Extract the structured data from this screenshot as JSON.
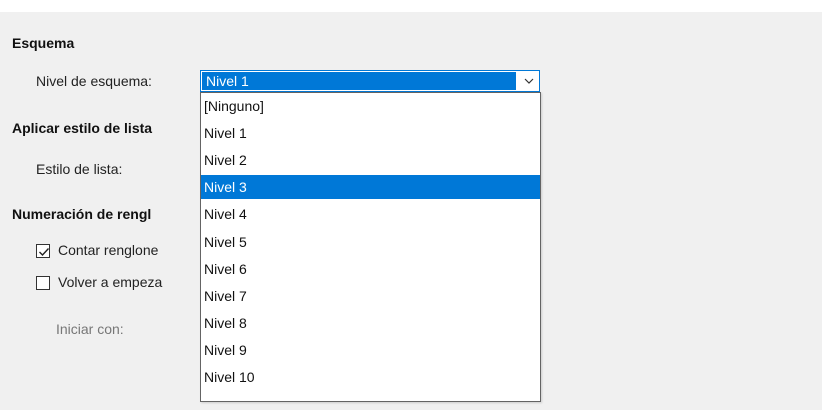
{
  "sections": {
    "outline": {
      "heading": "Esquema",
      "level_label": "Nivel de esquema:",
      "level_value": "Nivel 1"
    },
    "list_style": {
      "heading": "Aplicar estilo de lista",
      "style_label": "Estilo de lista:"
    },
    "line_numbering": {
      "heading": "Numeración de rengl",
      "count_lines": {
        "label": "Contar renglone",
        "checked": true
      },
      "restart": {
        "label": "Volver a empeza",
        "checked": false
      },
      "start_with_label": "Iniciar con:"
    }
  },
  "dropdown": {
    "highlighted": "Nivel 3",
    "options": [
      "[Ninguno]",
      "Nivel 1",
      "Nivel 2",
      "Nivel 3",
      "Nivel 4",
      "Nivel 5",
      "Nivel 6",
      "Nivel 7",
      "Nivel 8",
      "Nivel 9",
      "Nivel 10"
    ]
  },
  "icons": {
    "combo_arrow": "chevron-down-icon",
    "checkmark": "checkmark-icon"
  },
  "colors": {
    "panel_bg": "#f0f0f0",
    "selection": "#0078d7",
    "selection_text": "#ffffff",
    "border": "#646464"
  }
}
